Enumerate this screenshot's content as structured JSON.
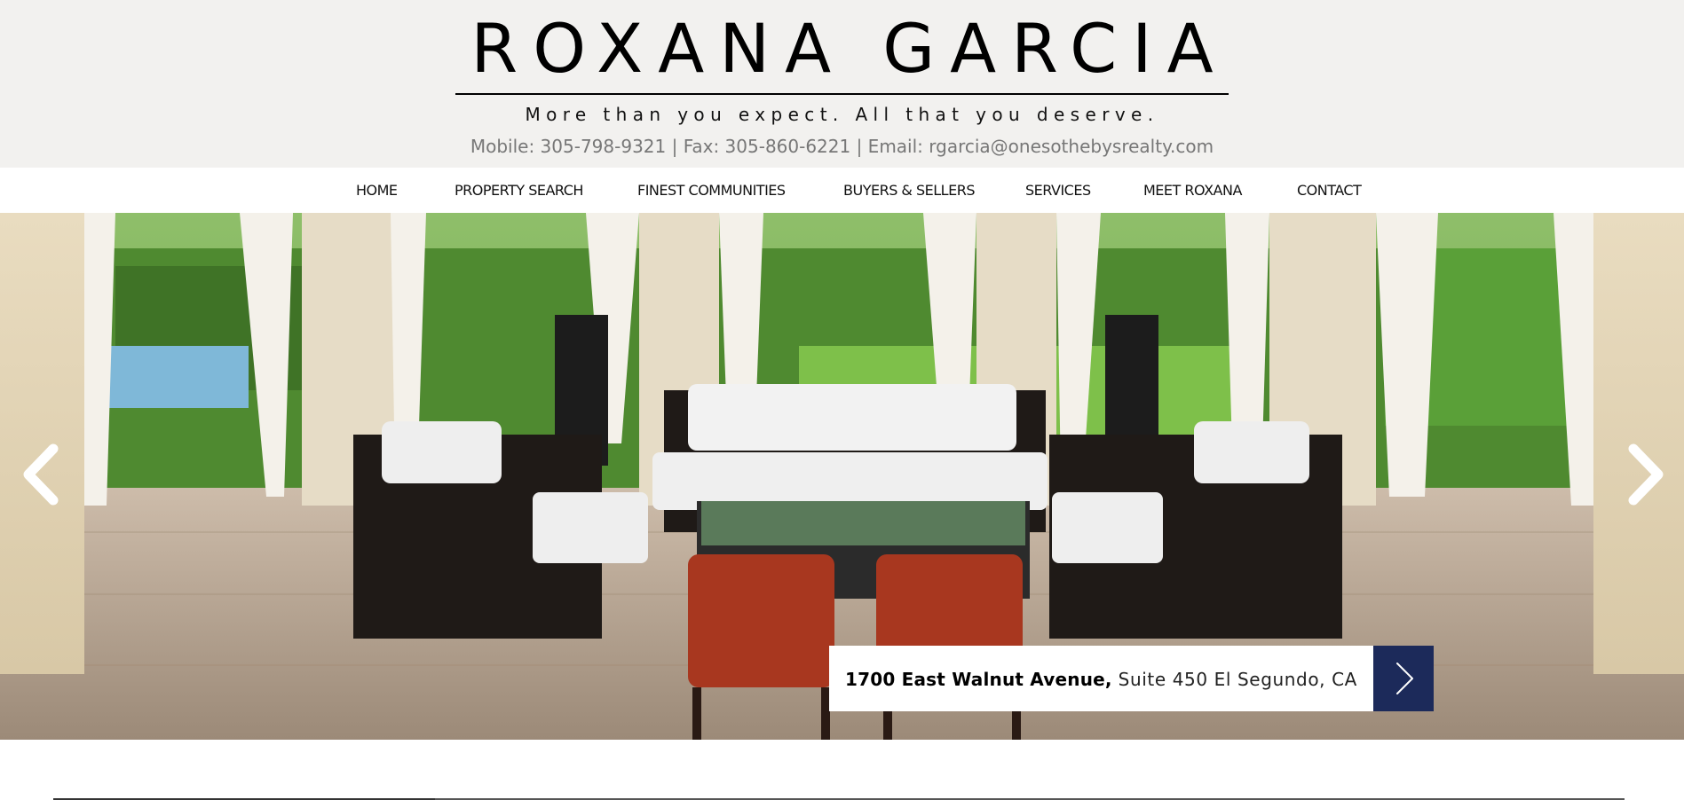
{
  "header": {
    "brand_name": "ROXANA GARCIA",
    "tagline": "More than you expect. All that you deserve.",
    "contact_line": "Mobile: 305-798-9321 | Fax: 305-860-6221 | Email: rgarcia@onesothebysrealty.com"
  },
  "nav": {
    "items": [
      {
        "label": "HOME"
      },
      {
        "label": "PROPERTY SEARCH"
      },
      {
        "label": "FINEST COMMUNITIES"
      },
      {
        "label": "BUYERS & SELLERS"
      },
      {
        "label": "SERVICES"
      },
      {
        "label": "MEET ROXANA"
      },
      {
        "label": "CONTACT"
      }
    ]
  },
  "slider": {
    "prev_icon": "chevron-left-icon",
    "next_icon": "chevron-right-icon",
    "address_street": "1700 East Walnut Avenue,",
    "address_rest": " Suite 450 El Segundo, CA",
    "address_button_icon": "chevron-right-icon"
  },
  "colors": {
    "header_bg": "#f2f1ef",
    "nav_bg": "#ffffff",
    "accent_navy": "#1c2a5a",
    "contact_text": "#777777"
  }
}
